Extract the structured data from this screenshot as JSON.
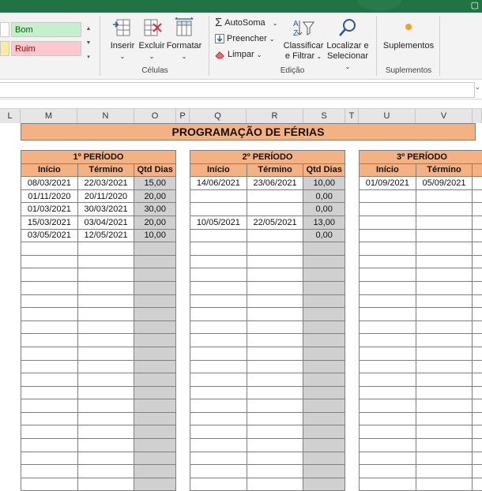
{
  "styles": {
    "bom": "Bom",
    "ruim": "Ruim"
  },
  "ribbon": {
    "cells": {
      "inserir": "Inserir",
      "excluir": "Excluir",
      "formatar": "Formatar",
      "group_label": "Células"
    },
    "edit": {
      "autosoma": "AutoSoma",
      "preencher": "Preencher",
      "limpar": "Limpar",
      "classificar_l1": "Classificar",
      "classificar_l2": "e Filtrar",
      "localizar_l1": "Localizar e",
      "localizar_l2": "Selecionar",
      "group_label": "Edição"
    },
    "addins": {
      "suplementos": "Suplementos",
      "group_label": "Suplementos"
    }
  },
  "columns": [
    "L",
    "M",
    "N",
    "O",
    "P",
    "Q",
    "R",
    "S",
    "T",
    "U",
    "V"
  ],
  "title": "PROGRAMAÇÃO DE FÉRIAS",
  "periods": [
    {
      "name": "1º PERÍODO",
      "headers": [
        "Início",
        "Término",
        "Qtd Dias"
      ],
      "rows": [
        [
          "08/03/2021",
          "22/03/2021",
          "15,00"
        ],
        [
          "01/11/2020",
          "20/11/2020",
          "20,00"
        ],
        [
          "01/03/2021",
          "30/03/2021",
          "30,00"
        ],
        [
          "15/03/2021",
          "03/04/2021",
          "20,00"
        ],
        [
          "03/05/2021",
          "12/05/2021",
          "10,00"
        ]
      ]
    },
    {
      "name": "2º PERÍODO",
      "headers": [
        "Início",
        "Término",
        "Qtd Dias"
      ],
      "rows": [
        [
          "14/06/2021",
          "23/06/2021",
          "10,00"
        ],
        [
          "",
          "",
          "0,00"
        ],
        [
          "",
          "",
          "0,00"
        ],
        [
          "10/05/2021",
          "22/05/2021",
          "13,00"
        ],
        [
          "",
          "",
          "0,00"
        ]
      ]
    },
    {
      "name": "3º PERÍODO",
      "headers": [
        "Início",
        "Término"
      ],
      "rows": [
        [
          "01/09/2021",
          "05/09/2021"
        ],
        [
          "",
          ""
        ],
        [
          "",
          ""
        ],
        [
          "",
          ""
        ],
        [
          "",
          ""
        ]
      ]
    }
  ],
  "colors": {
    "excel_green": "#217346",
    "header_orange": "#f4b183",
    "qtd_gray": "#d0d0d0"
  }
}
